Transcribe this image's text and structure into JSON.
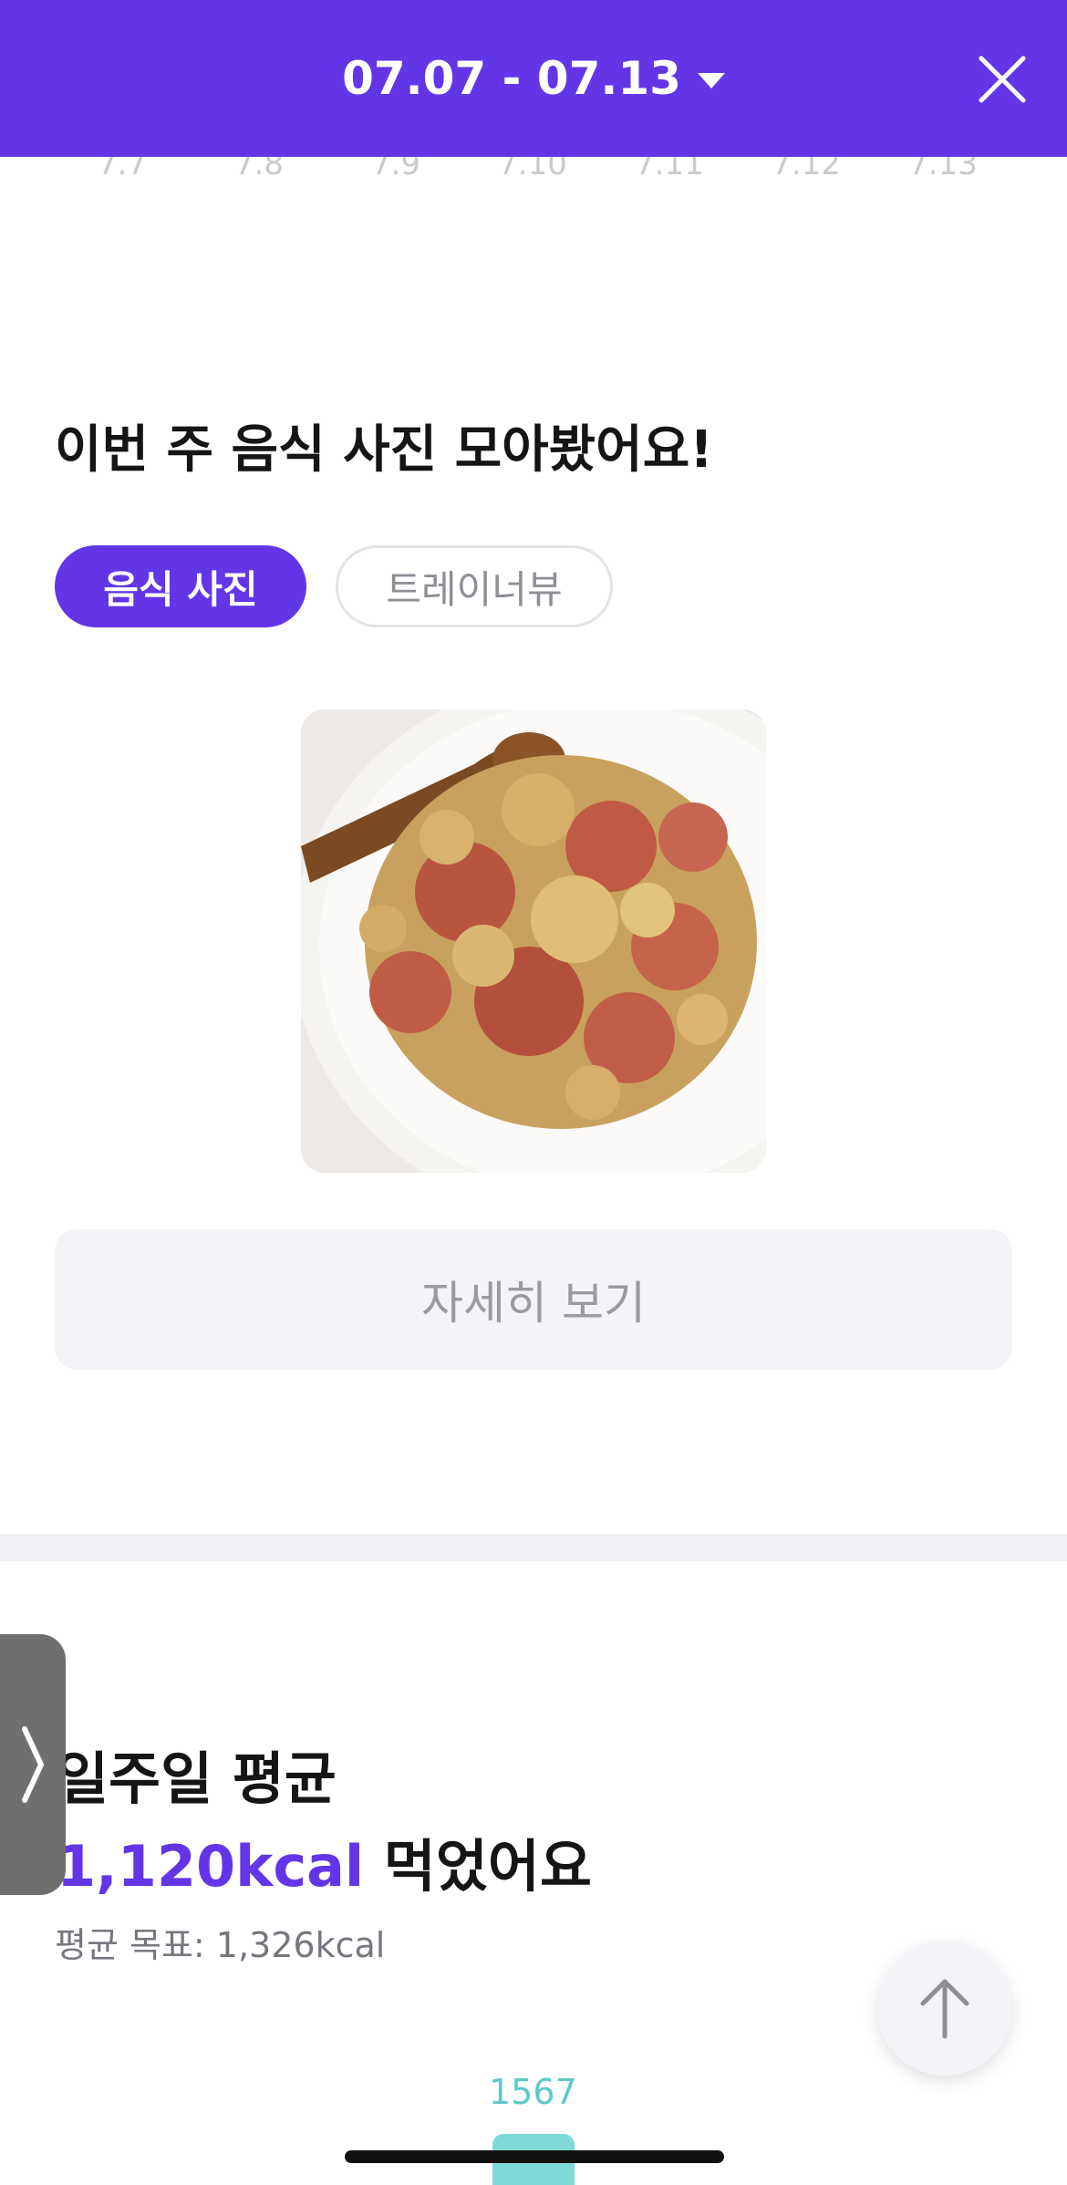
{
  "header": {
    "date_range": "07.07 - 07.13"
  },
  "day_axis": [
    "7.7",
    "7.8",
    "7.9",
    "7.10",
    "7.11",
    "7.12",
    "7.13"
  ],
  "food_section": {
    "title": "이번 주 음식 사진 모아봤어요!",
    "tabs": [
      {
        "label": "음식 사진",
        "active": true
      },
      {
        "label": "트레이너뷰",
        "active": false
      }
    ],
    "photo_alt": "tomato and scrambled eggs on a plate",
    "detail_button": "자세히 보기"
  },
  "average_section": {
    "line1": "일주일 평균",
    "kcal_value": "1,120kcal",
    "line2_suffix": " 먹었어요",
    "goal": "평균 목표: 1,326kcal"
  },
  "chart_preview": {
    "bar_label": "1567"
  },
  "colors": {
    "accent": "#6236e6",
    "bar": "#7fd9d6",
    "bar_label": "#5fc8c8"
  },
  "icons": {
    "header_caret": "caret-down-icon",
    "close": "close-icon",
    "side": "chevron-right-icon",
    "scroll": "arrow-up-icon"
  }
}
